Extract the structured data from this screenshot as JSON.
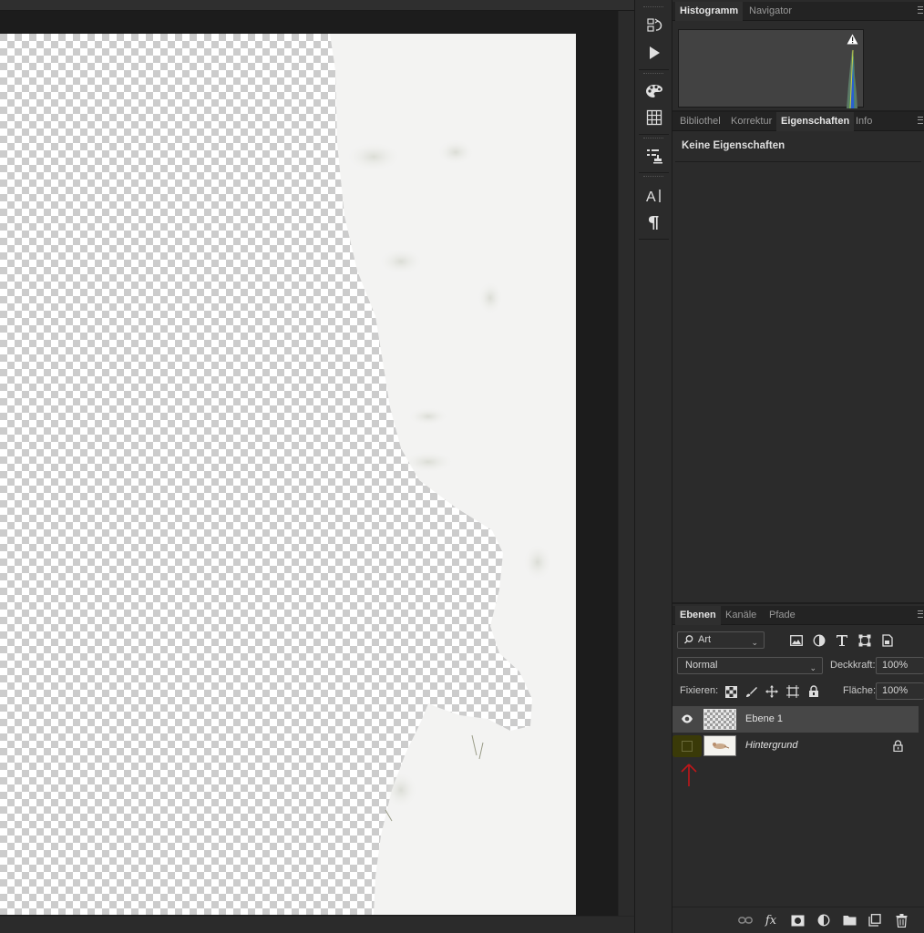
{
  "dock": {
    "tools": [
      {
        "icon": "history-icon",
        "glyph": "⇅"
      },
      {
        "icon": "play-actions-icon",
        "glyph": "▶"
      },
      {
        "icon": "swatches-icon",
        "glyph": "🎨"
      },
      {
        "icon": "grid-icon",
        "glyph": "▦"
      },
      {
        "icon": "clone-source-icon",
        "glyph": "☷"
      },
      {
        "icon": "character-icon",
        "glyph": "A|"
      },
      {
        "icon": "paragraph-icon",
        "glyph": "¶"
      }
    ]
  },
  "histogram_panel": {
    "tabs": [
      "Histogramm",
      "Navigator"
    ],
    "active_tab": "Histogramm"
  },
  "properties_panel": {
    "tabs": [
      "Bibliothel",
      "Korrektur",
      "Eigenschaften",
      "Info"
    ],
    "active_tab": "Eigenschaften",
    "empty_text": "Keine Eigenschaften"
  },
  "layers_panel": {
    "tabs": [
      "Ebenen",
      "Kanäle",
      "Pfade"
    ],
    "active_tab": "Ebenen",
    "filter": {
      "value": "Art",
      "icon": "search-icon"
    },
    "filter_icons": [
      "image-filter-icon",
      "adjustment-filter-icon",
      "type-filter-icon",
      "shape-filter-icon",
      "smart-object-filter-icon"
    ],
    "blend_mode": "Normal",
    "opacity_label": "Deckkraft:",
    "opacity_value": "100%",
    "lock_label": "Fixieren:",
    "lock_icons": [
      "lock-transparent-icon",
      "lock-brush-icon",
      "lock-position-icon",
      "lock-artboard-icon",
      "lock-all-icon"
    ],
    "fill_label": "Fläche:",
    "fill_value": "100%",
    "layers": [
      {
        "name": "Ebene 1",
        "visible": true,
        "selected": true,
        "locked": false
      },
      {
        "name": "Hintergrund",
        "visible": false,
        "selected": false,
        "locked": true
      }
    ],
    "bottom_icons": [
      "link-layers-icon",
      "fx-icon",
      "mask-icon",
      "adjustment-layer-icon",
      "group-folder-icon",
      "new-layer-icon",
      "trash-icon"
    ]
  },
  "colors": {
    "panel_bg": "#2b2b2b",
    "selected_row": "#474747",
    "annotation_arrow": "#c0161a",
    "highlight": "#3a3a08"
  }
}
